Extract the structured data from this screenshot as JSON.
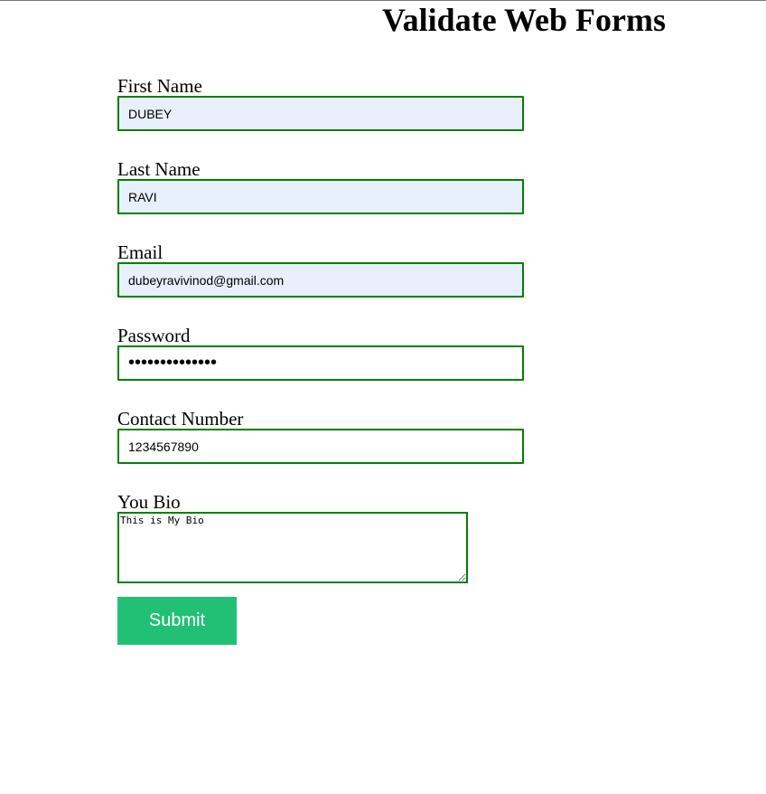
{
  "page": {
    "title": "Validate Web Forms"
  },
  "form": {
    "first_name": {
      "label": "First Name",
      "value": "DUBEY"
    },
    "last_name": {
      "label": "Last Name",
      "value": "RAVI"
    },
    "email": {
      "label": "Email",
      "value": "dubeyravivinod@gmail.com"
    },
    "password": {
      "label": "Password",
      "value": "aaaaaaaaaaaaaa"
    },
    "contact": {
      "label": "Contact Number",
      "value": "1234567890"
    },
    "bio": {
      "label": "You Bio",
      "value": "This is My Bio"
    },
    "submit_label": "Submit"
  },
  "colors": {
    "input_border": "#008000",
    "autofill_bg": "#e8f0fe",
    "submit_bg": "#22c075"
  }
}
